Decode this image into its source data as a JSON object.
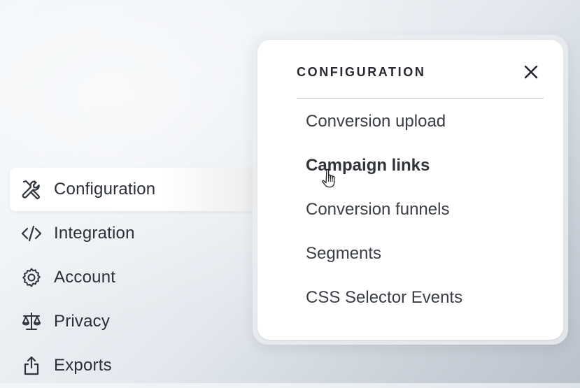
{
  "sidebar": {
    "items": [
      {
        "label": "Configuration",
        "icon": "tools-icon",
        "active": true
      },
      {
        "label": "Integration",
        "icon": "code-icon",
        "active": false
      },
      {
        "label": "Account",
        "icon": "gear-icon",
        "active": false
      },
      {
        "label": "Privacy",
        "icon": "scale-icon",
        "active": false
      },
      {
        "label": "Exports",
        "icon": "share-icon",
        "active": false
      }
    ]
  },
  "popover": {
    "title": "CONFIGURATION",
    "close_icon": "close-icon",
    "items": [
      {
        "label": "Conversion upload"
      },
      {
        "label": "Campaign links",
        "hovered": true
      },
      {
        "label": "Conversion funnels"
      },
      {
        "label": "Segments"
      },
      {
        "label": "CSS Selector Events"
      }
    ]
  },
  "colors": {
    "text": "#2b2f36",
    "popover_bg": "#ffffff",
    "divider": "#bfc3c8"
  },
  "cursor": "hand-pointer-icon"
}
